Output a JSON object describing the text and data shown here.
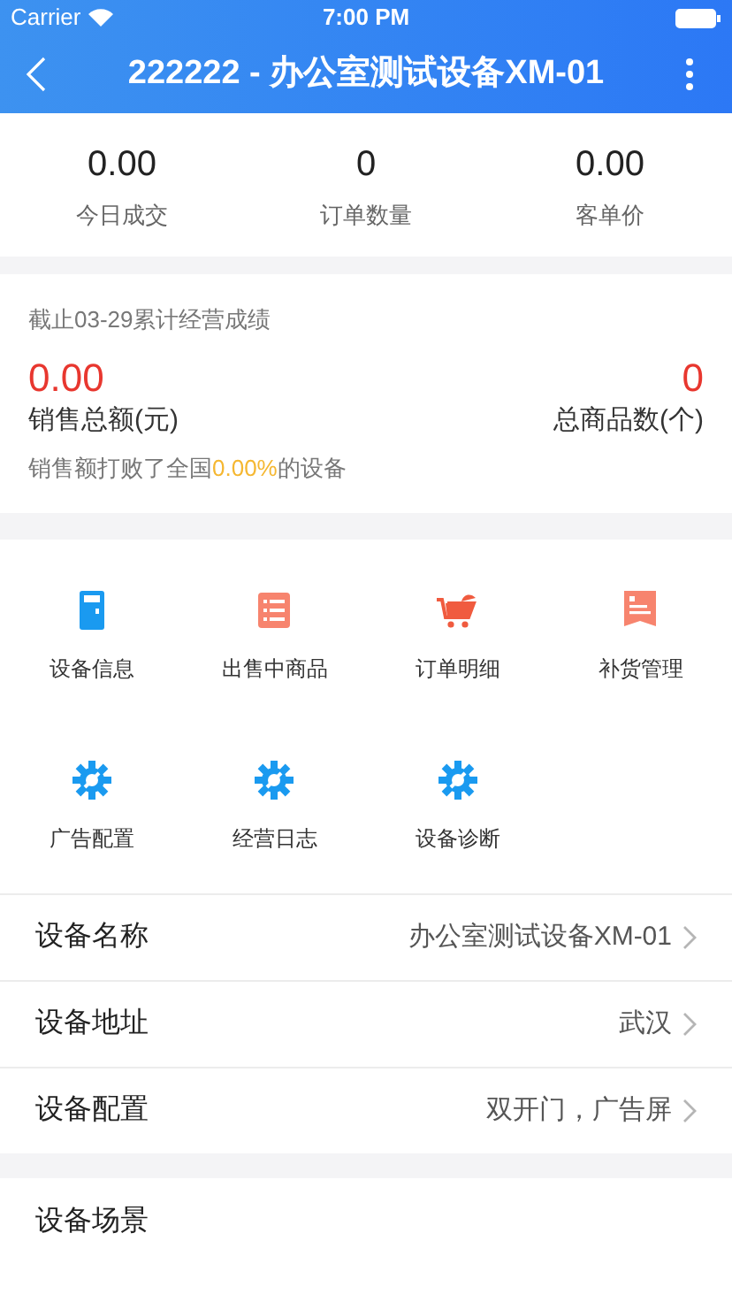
{
  "status_bar": {
    "carrier": "Carrier",
    "time": "7:00 PM"
  },
  "nav": {
    "title": "222222 - 办公室测试设备XM-01"
  },
  "today_stats": [
    {
      "value": "0.00",
      "label": "今日成交"
    },
    {
      "value": "0",
      "label": "订单数量"
    },
    {
      "value": "0.00",
      "label": "客单价"
    }
  ],
  "cumulative": {
    "heading": "截止03-29累计经营成绩",
    "sales_value": "0.00",
    "sales_label": "销售总额(元)",
    "items_value": "0",
    "items_label": "总商品数(个)",
    "ranking_before": "销售额打败了全国",
    "ranking_percent": "0.00%",
    "ranking_after": "的设备"
  },
  "menu_grid": [
    {
      "kind": "device",
      "label": "设备信息"
    },
    {
      "kind": "list",
      "label": "出售中商品"
    },
    {
      "kind": "cart",
      "label": "订单明细"
    },
    {
      "kind": "doc",
      "label": "补货管理"
    },
    {
      "kind": "gear",
      "label": "广告配置"
    },
    {
      "kind": "gear",
      "label": "经营日志"
    },
    {
      "kind": "gear",
      "label": "设备诊断"
    }
  ],
  "info_rows": [
    {
      "label": "设备名称",
      "value": "办公室测试设备XM-01"
    },
    {
      "label": "设备地址",
      "value": "武汉"
    },
    {
      "label": "设备配置",
      "value": "双开门，广告屏"
    }
  ],
  "scene_row": {
    "label": "设备场景"
  }
}
